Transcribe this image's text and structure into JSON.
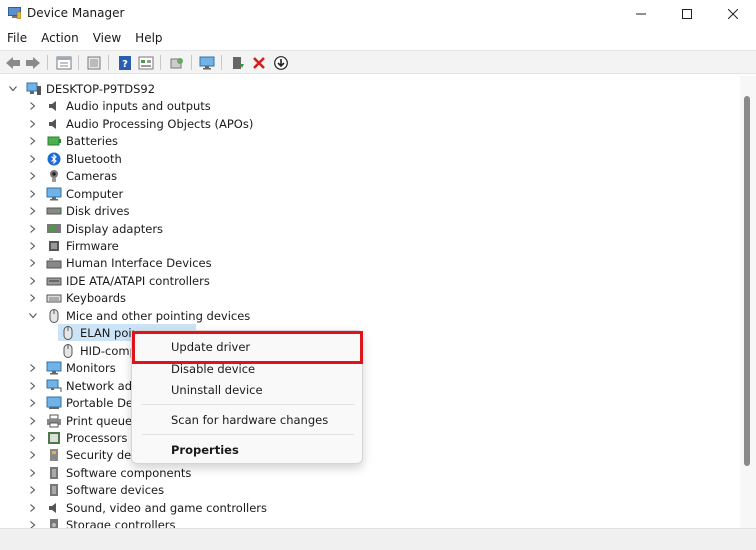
{
  "window": {
    "title": "Device Manager"
  },
  "menu": [
    "File",
    "Action",
    "View",
    "Help"
  ],
  "toolbar": {
    "icons": [
      "back-icon",
      "forward-icon",
      "properties-view-icon",
      "device-list-icon",
      "help-icon",
      "resource-view-icon",
      "scan-icon",
      "monitor-icon",
      "add-driver-icon",
      "uninstall-icon",
      "download-icon"
    ]
  },
  "tree": {
    "root": "DESKTOP-P9TDS92",
    "categories": [
      {
        "label": "Audio inputs and outputs",
        "icon": "speaker-icon"
      },
      {
        "label": "Audio Processing Objects (APOs)",
        "icon": "speaker-icon"
      },
      {
        "label": "Batteries",
        "icon": "battery-icon"
      },
      {
        "label": "Bluetooth",
        "icon": "bluetooth-icon"
      },
      {
        "label": "Cameras",
        "icon": "camera-icon"
      },
      {
        "label": "Computer",
        "icon": "computer-icon"
      },
      {
        "label": "Disk drives",
        "icon": "disk-icon"
      },
      {
        "label": "Display adapters",
        "icon": "display-adapter-icon"
      },
      {
        "label": "Firmware",
        "icon": "chip-icon"
      },
      {
        "label": "Human Interface Devices",
        "icon": "hid-icon"
      },
      {
        "label": "IDE ATA/ATAPI controllers",
        "icon": "ide-icon"
      },
      {
        "label": "Keyboards",
        "icon": "keyboard-icon"
      },
      {
        "label": "Mice and other pointing devices",
        "icon": "mouse-icon"
      }
    ],
    "mice_children": [
      "ELAN poin",
      "HID-comp"
    ],
    "categories_after": [
      {
        "label": "Monitors",
        "icon": "monitor-icon"
      },
      {
        "label": "Network adap",
        "icon": "network-icon"
      },
      {
        "label": "Portable Devic",
        "icon": "portable-device-icon"
      },
      {
        "label": "Print queues",
        "icon": "printer-icon"
      },
      {
        "label": "Processors",
        "icon": "processor-icon"
      },
      {
        "label": "Security device",
        "icon": "security-icon"
      },
      {
        "label": "Software components",
        "icon": "software-icon"
      },
      {
        "label": "Software devices",
        "icon": "software-icon"
      },
      {
        "label": "Sound, video and game controllers",
        "icon": "speaker-icon"
      },
      {
        "label": "Storage controllers",
        "icon": "storage-icon"
      }
    ]
  },
  "context_menu": {
    "update_driver": "Update driver",
    "disable_device": "Disable device",
    "uninstall_device": "Uninstall device",
    "scan": "Scan for hardware changes",
    "properties": "Properties"
  },
  "colors": {
    "highlight": "#e0121b",
    "selection": "#cce4f7"
  }
}
